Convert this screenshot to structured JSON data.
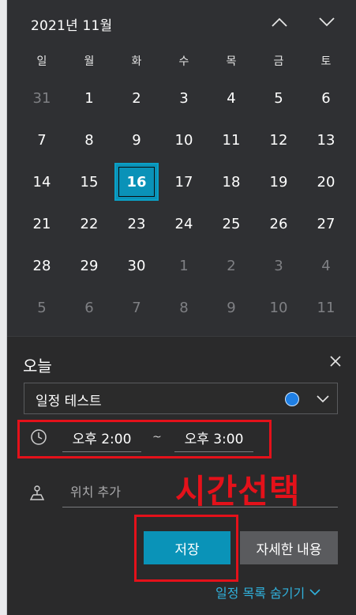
{
  "calendar": {
    "month_title": "2021년 11월",
    "weekdays": [
      "일",
      "월",
      "화",
      "수",
      "목",
      "금",
      "토"
    ],
    "weeks": [
      [
        {
          "d": "31",
          "o": true
        },
        {
          "d": "1"
        },
        {
          "d": "2"
        },
        {
          "d": "3"
        },
        {
          "d": "4"
        },
        {
          "d": "5"
        },
        {
          "d": "6"
        }
      ],
      [
        {
          "d": "7"
        },
        {
          "d": "8"
        },
        {
          "d": "9"
        },
        {
          "d": "10"
        },
        {
          "d": "11"
        },
        {
          "d": "12"
        },
        {
          "d": "13"
        }
      ],
      [
        {
          "d": "14"
        },
        {
          "d": "15"
        },
        {
          "d": "16",
          "t": true
        },
        {
          "d": "17"
        },
        {
          "d": "18"
        },
        {
          "d": "19"
        },
        {
          "d": "20"
        }
      ],
      [
        {
          "d": "21"
        },
        {
          "d": "22"
        },
        {
          "d": "23"
        },
        {
          "d": "24"
        },
        {
          "d": "25"
        },
        {
          "d": "26"
        },
        {
          "d": "27"
        }
      ],
      [
        {
          "d": "28"
        },
        {
          "d": "29"
        },
        {
          "d": "30"
        },
        {
          "d": "1",
          "o": true
        },
        {
          "d": "2",
          "o": true
        },
        {
          "d": "3",
          "o": true
        },
        {
          "d": "4",
          "o": true
        }
      ],
      [
        {
          "d": "5",
          "o": true
        },
        {
          "d": "6",
          "o": true
        },
        {
          "d": "7",
          "o": true
        },
        {
          "d": "8",
          "o": true
        },
        {
          "d": "9",
          "o": true
        },
        {
          "d": "10",
          "o": true
        },
        {
          "d": "11",
          "o": true
        }
      ]
    ]
  },
  "event_panel": {
    "title": "오늘",
    "event_name_value": "일정 테스트",
    "event_color": "#1f7fe4",
    "start_time": "오후 2:00",
    "time_separator": "~",
    "end_time": "오후 3:00",
    "location_placeholder": "위치 추가",
    "save_label": "저장",
    "details_label": "자세한 내용",
    "hide_list_label": "일정 목록 숨기기"
  },
  "annotation": {
    "text": "시간선택",
    "color": "#e4111a"
  },
  "colors": {
    "accent": "#0a93b8",
    "link": "#30b2dd"
  }
}
